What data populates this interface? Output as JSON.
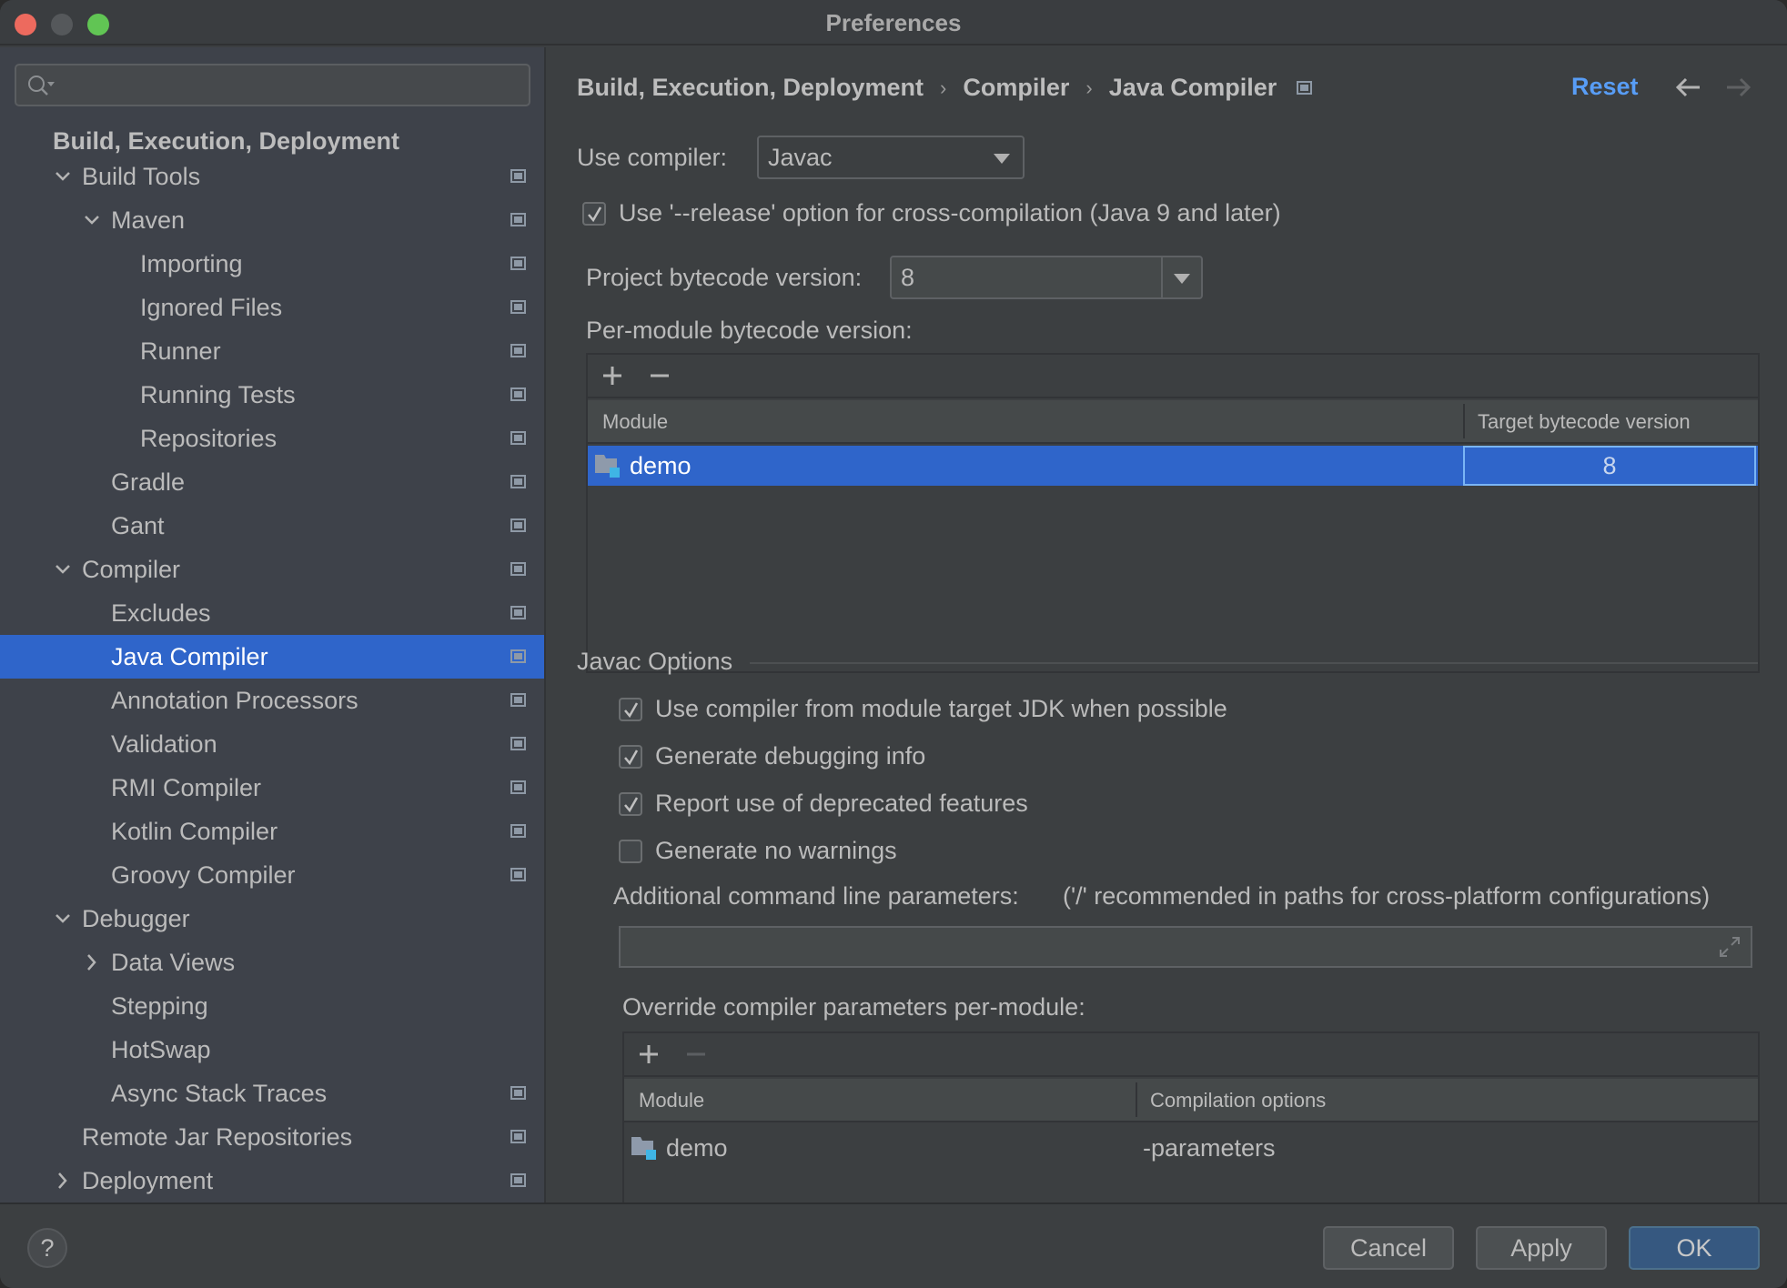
{
  "window": {
    "title": "Preferences"
  },
  "sidebar": {
    "search_placeholder": "",
    "section_title": "Build, Execution, Deployment",
    "items": [
      {
        "label": "Build Tools",
        "level": 1,
        "expander": "expanded",
        "project_icon": true,
        "selected": false
      },
      {
        "label": "Maven",
        "level": 2,
        "expander": "expanded",
        "project_icon": true,
        "selected": false
      },
      {
        "label": "Importing",
        "level": 3,
        "expander": "none",
        "project_icon": true,
        "selected": false
      },
      {
        "label": "Ignored Files",
        "level": 3,
        "expander": "none",
        "project_icon": true,
        "selected": false
      },
      {
        "label": "Runner",
        "level": 3,
        "expander": "none",
        "project_icon": true,
        "selected": false
      },
      {
        "label": "Running Tests",
        "level": 3,
        "expander": "none",
        "project_icon": true,
        "selected": false
      },
      {
        "label": "Repositories",
        "level": 3,
        "expander": "none",
        "project_icon": true,
        "selected": false
      },
      {
        "label": "Gradle",
        "level": 2,
        "expander": "none",
        "project_icon": true,
        "selected": false
      },
      {
        "label": "Gant",
        "level": 2,
        "expander": "none",
        "project_icon": true,
        "selected": false
      },
      {
        "label": "Compiler",
        "level": 1,
        "expander": "expanded",
        "project_icon": true,
        "selected": false
      },
      {
        "label": "Excludes",
        "level": 2,
        "expander": "none",
        "project_icon": true,
        "selected": false
      },
      {
        "label": "Java Compiler",
        "level": 2,
        "expander": "none",
        "project_icon": true,
        "selected": true
      },
      {
        "label": "Annotation Processors",
        "level": 2,
        "expander": "none",
        "project_icon": true,
        "selected": false
      },
      {
        "label": "Validation",
        "level": 2,
        "expander": "none",
        "project_icon": true,
        "selected": false
      },
      {
        "label": "RMI Compiler",
        "level": 2,
        "expander": "none",
        "project_icon": true,
        "selected": false
      },
      {
        "label": "Kotlin Compiler",
        "level": 2,
        "expander": "none",
        "project_icon": true,
        "selected": false
      },
      {
        "label": "Groovy Compiler",
        "level": 2,
        "expander": "none",
        "project_icon": true,
        "selected": false
      },
      {
        "label": "Debugger",
        "level": 1,
        "expander": "expanded",
        "project_icon": false,
        "selected": false
      },
      {
        "label": "Data Views",
        "level": 2,
        "expander": "collapsed",
        "project_icon": false,
        "selected": false
      },
      {
        "label": "Stepping",
        "level": 2,
        "expander": "none",
        "project_icon": false,
        "selected": false
      },
      {
        "label": "HotSwap",
        "level": 2,
        "expander": "none",
        "project_icon": false,
        "selected": false
      },
      {
        "label": "Async Stack Traces",
        "level": 2,
        "expander": "none",
        "project_icon": true,
        "selected": false
      },
      {
        "label": "Remote Jar Repositories",
        "level": 1,
        "expander": "none",
        "project_icon": true,
        "selected": false
      },
      {
        "label": "Deployment",
        "level": 1,
        "expander": "collapsed",
        "project_icon": true,
        "selected": false
      }
    ]
  },
  "header": {
    "breadcrumbs": [
      "Build, Execution, Deployment",
      "Compiler",
      "Java Compiler"
    ],
    "separator": "›",
    "reset_label": "Reset",
    "back_icon": "arrow-left-icon",
    "forward_icon": "arrow-right-icon"
  },
  "compiler": {
    "use_compiler_label": "Use compiler:",
    "use_compiler_value": "Javac",
    "release_option": {
      "label": "Use '--release' option for cross-compilation (Java 9 and later)",
      "checked": true
    },
    "project_bytecode_label": "Project bytecode version:",
    "project_bytecode_value": "8",
    "per_module_label": "Per-module bytecode version:",
    "per_module_table": {
      "columns": [
        "Module",
        "Target bytecode version"
      ],
      "rows": [
        {
          "module": "demo",
          "target": "8",
          "selected": true
        }
      ]
    }
  },
  "javac_options": {
    "title": "Javac Options",
    "checkboxes": [
      {
        "label": "Use compiler from module target JDK when possible",
        "checked": true
      },
      {
        "label": "Generate debugging info",
        "checked": true
      },
      {
        "label": "Report use of deprecated features",
        "checked": true
      },
      {
        "label": "Generate no warnings",
        "checked": false
      }
    ],
    "additional_params_label": "Additional command line parameters:",
    "additional_params_hint": "('/' recommended in paths for cross-platform configurations)",
    "additional_params_value": "",
    "override_label": "Override compiler parameters per-module:",
    "override_table": {
      "columns": [
        "Module",
        "Compilation options"
      ],
      "rows": [
        {
          "module": "demo",
          "options": "-parameters"
        }
      ]
    }
  },
  "footer": {
    "help_label": "?",
    "cancel_label": "Cancel",
    "apply_label": "Apply",
    "ok_label": "OK"
  },
  "colors": {
    "accent": "#2f65ca",
    "link": "#589df6",
    "primary_button": "#365880",
    "module_icon": "#3fb5e5"
  }
}
